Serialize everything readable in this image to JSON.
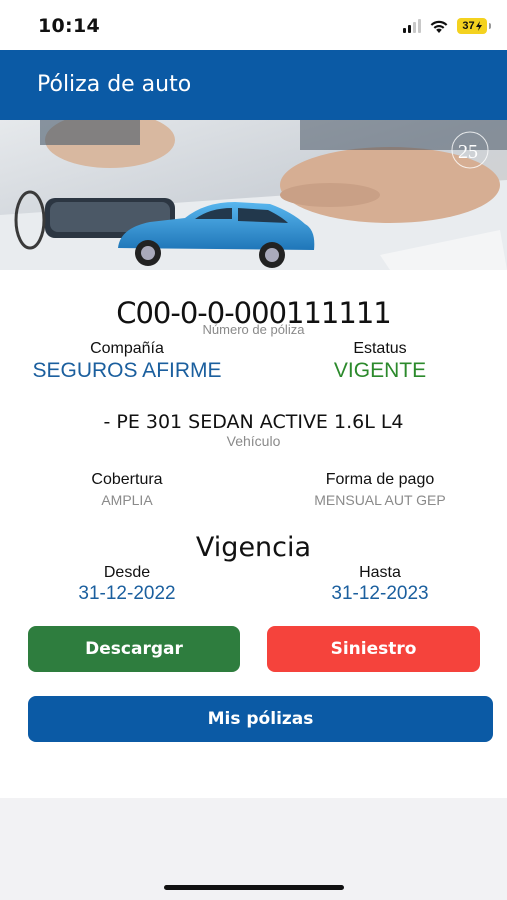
{
  "status_bar": {
    "time": "10:14",
    "battery": "37",
    "battery_color": "#f4d21f"
  },
  "header": {
    "title": "Póliza de auto",
    "color": "#0b5aa5"
  },
  "banner": {
    "logo_number": "25"
  },
  "policy": {
    "number": "C00-0-0-000111111",
    "number_label": "Número de póliza",
    "company_label": "Compañía",
    "company_value": "SEGUROS AFIRME",
    "status_label": "Estatus",
    "status_value": "VIGENTE",
    "vehicle": "- PE 301 SEDAN ACTIVE 1.6L L4",
    "vehicle_label": "Vehículo",
    "coverage_label": "Cobertura",
    "coverage_value": "AMPLIA",
    "payment_label": "Forma de pago",
    "payment_value": "MENSUAL AUT GEP",
    "validity_title": "Vigencia",
    "from_label": "Desde",
    "from_value": "31-12-2022",
    "to_label": "Hasta",
    "to_value": "31-12-2023"
  },
  "actions": {
    "download": "Descargar",
    "claim": "Siniestro",
    "my_policies": "Mis pólizas"
  },
  "colors": {
    "accent_blue": "#1b5f9e",
    "status_green": "#2c8a2c",
    "download_green": "#2e7d3e",
    "claim_red": "#f5433c"
  }
}
